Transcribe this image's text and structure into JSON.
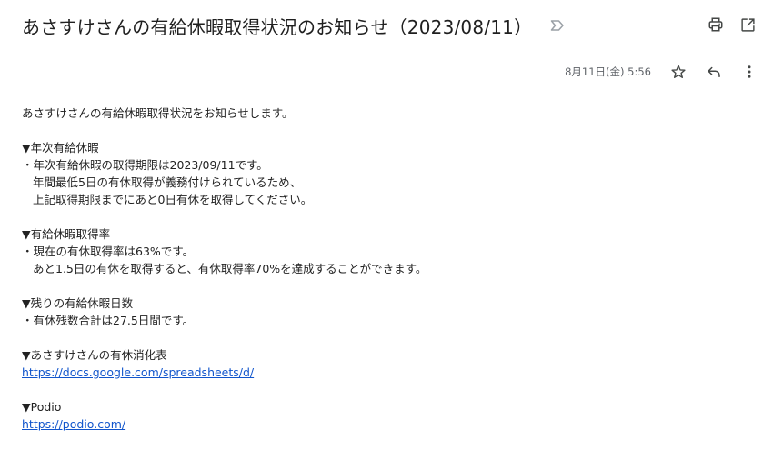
{
  "header": {
    "subject": "あさすけさんの有給休暇取得状況のお知らせ（2023/08/11）",
    "label_icon": "label-importance-icon",
    "actions": [
      {
        "name": "print-all",
        "icon": "print-icon"
      },
      {
        "name": "open-new-window",
        "icon": "open-in-new-icon"
      }
    ]
  },
  "message_meta": {
    "date": "8月11日(金) 5:56",
    "actions": [
      {
        "name": "star",
        "icon": "star-icon"
      },
      {
        "name": "reply",
        "icon": "reply-icon"
      },
      {
        "name": "more",
        "icon": "more-vert-icon"
      }
    ]
  },
  "message_body": {
    "intro": "あさすけさんの有給休暇取得状況をお知らせします。",
    "sections": [
      {
        "heading": "▼年次有給休暇",
        "lines": [
          "・年次有給休暇の取得期限は2023/09/11です。",
          "年間最低5日の有休取得が義務付けられているため、",
          "上記取得期限までにあと0日有休を取得してください。"
        ]
      },
      {
        "heading": "▼有給休暇取得率",
        "lines": [
          "・現在の有休取得率は63%です。",
          "あと1.5日の有休を取得すると、有休取得率70%を達成することができます。"
        ]
      },
      {
        "heading": "▼残りの有給休暇日数",
        "lines": [
          "・有休残数合計は27.5日間です。"
        ]
      },
      {
        "heading": "▼あさすけさんの有休消化表",
        "link": "https://docs.google.com/spreadsheets/d/"
      },
      {
        "heading": "▼Podio",
        "link": "https://podio.com/"
      }
    ]
  },
  "colors": {
    "text": "#222222",
    "meta": "#5f6368",
    "link": "#1155cc",
    "icon": "#444746"
  }
}
